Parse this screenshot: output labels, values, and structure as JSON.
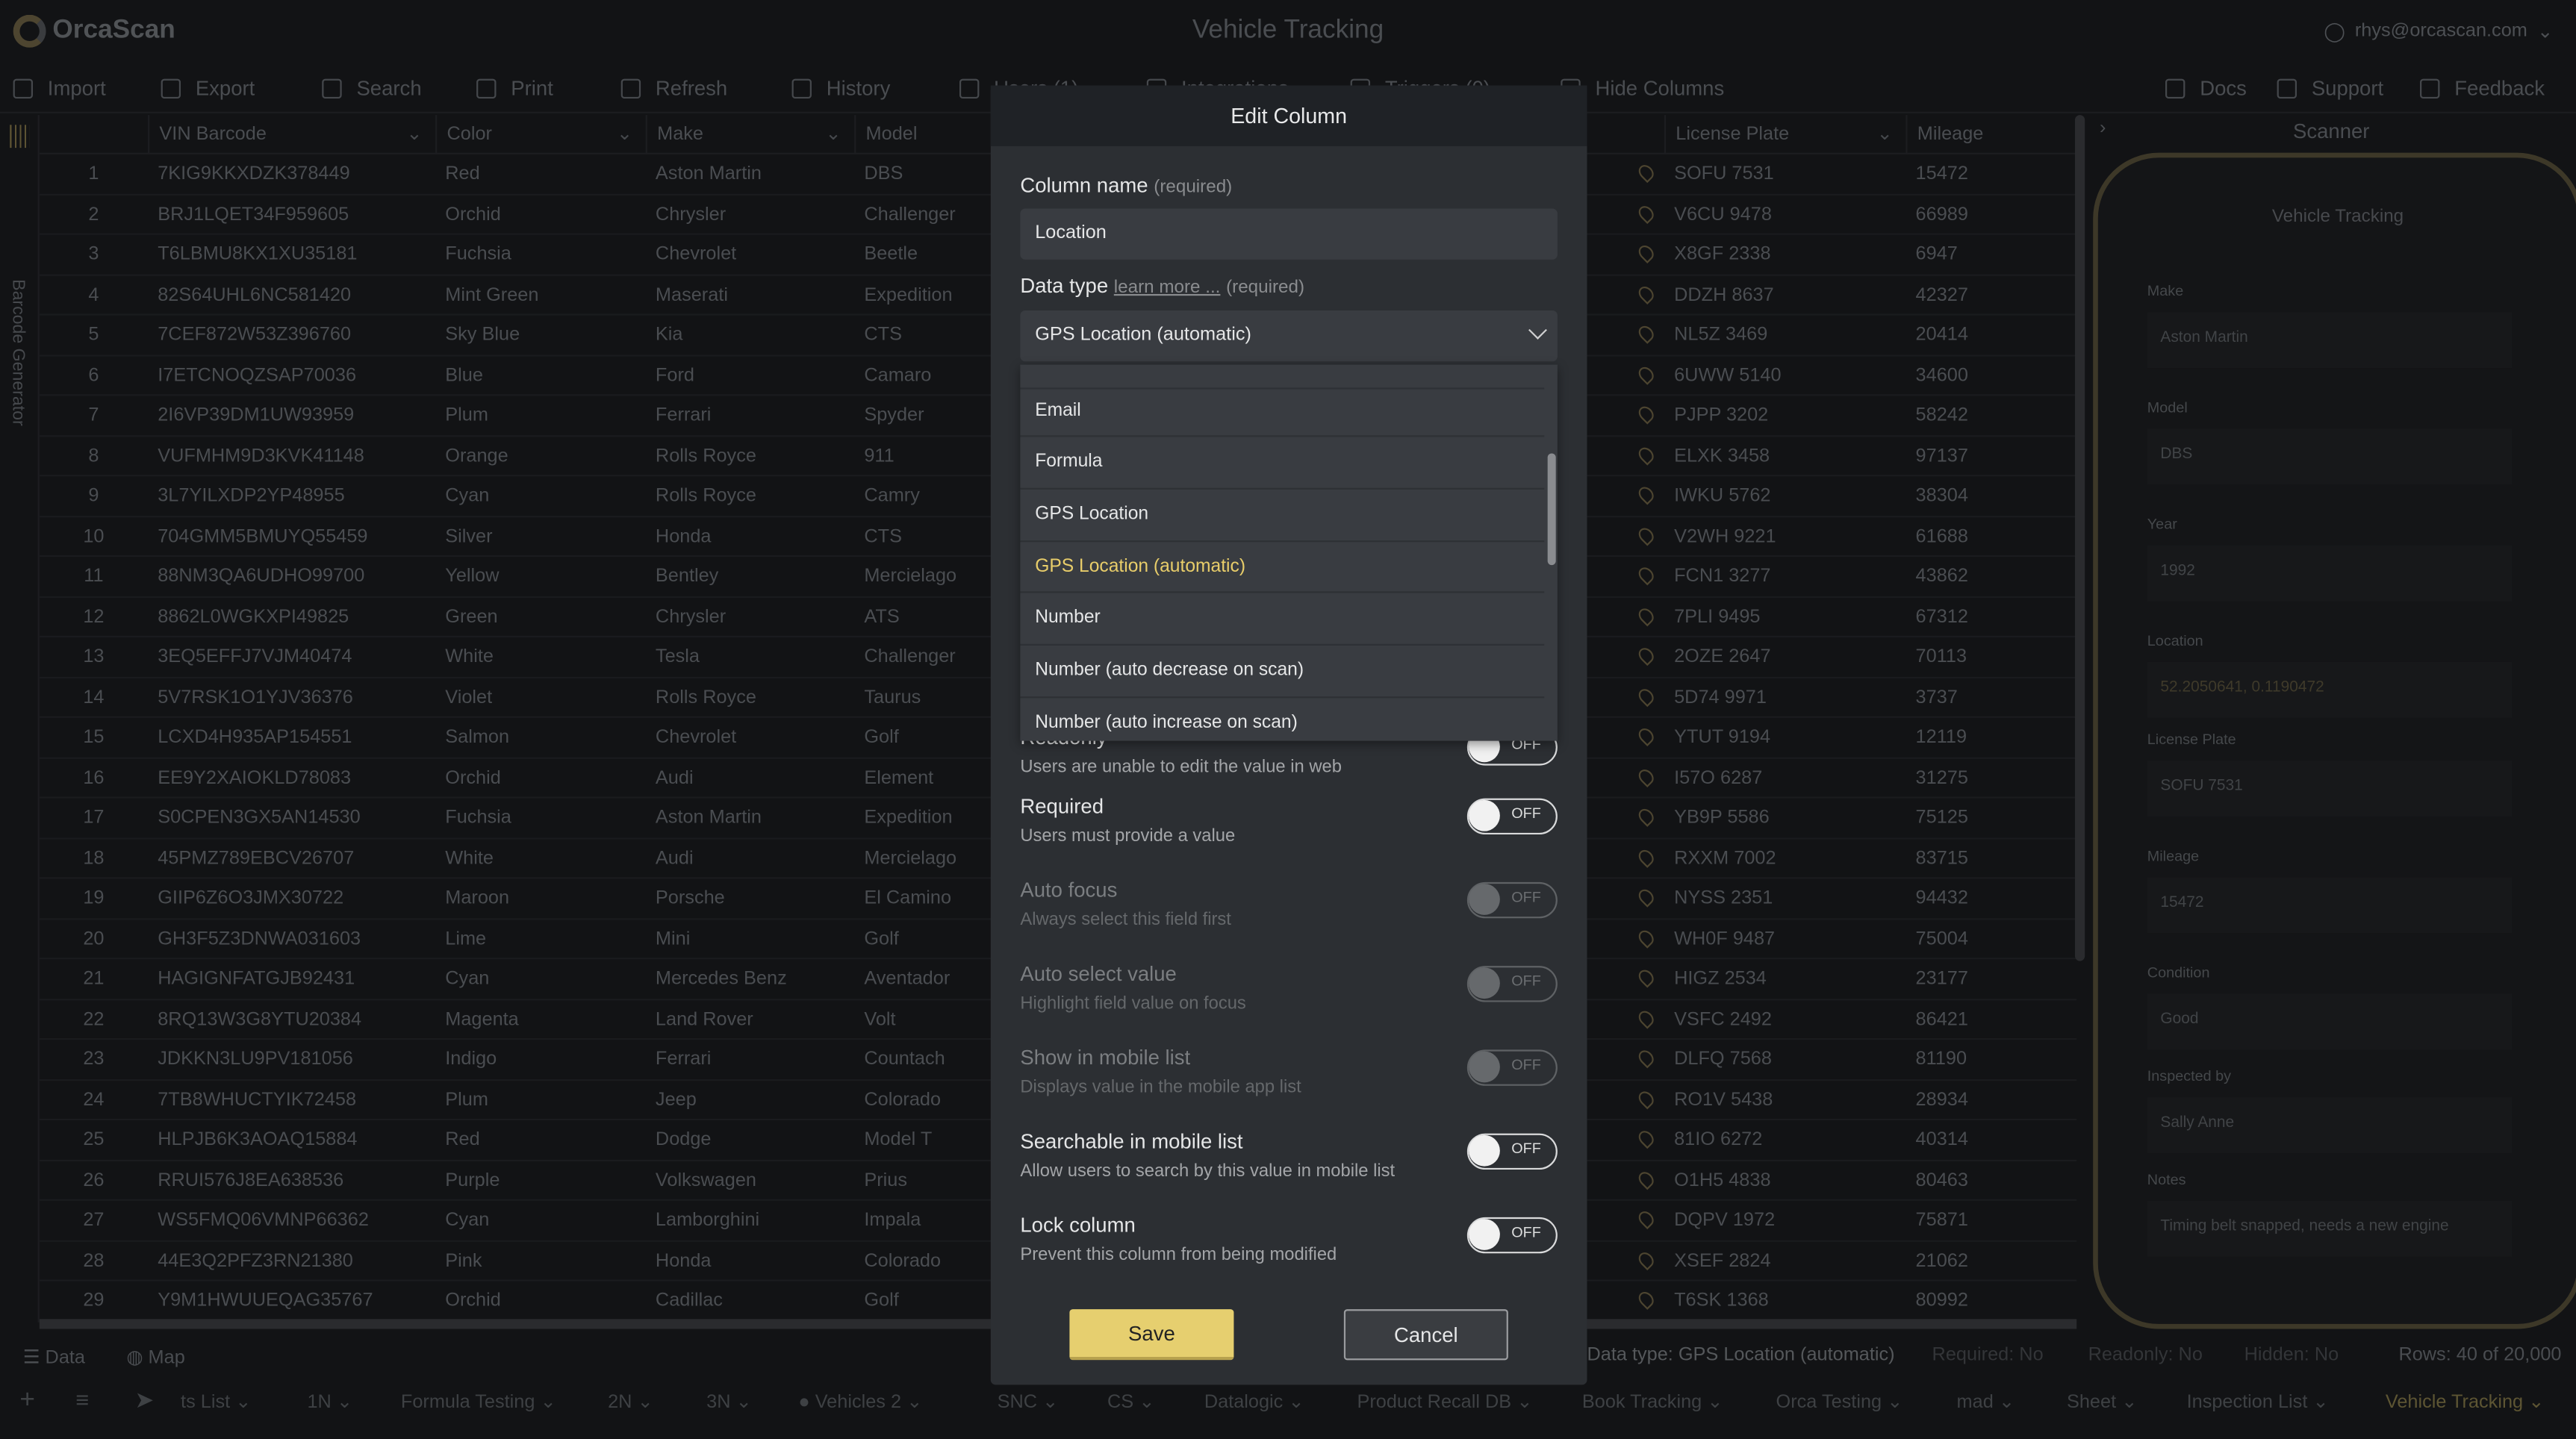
{
  "app": {
    "logo": "OrcaScan",
    "title": "Vehicle Tracking",
    "user_email": "rhys@orcascan.com"
  },
  "colors": {
    "accent": "#e6cf6f",
    "selected_option": "#e8cd6a",
    "background": "#121315",
    "dialog": "#2c2f33"
  },
  "toolbar": {
    "left": [
      {
        "label": "Import",
        "icon": "import-icon"
      },
      {
        "label": "Export",
        "icon": "export-icon"
      },
      {
        "label": "Search",
        "icon": "search-icon"
      },
      {
        "label": "Print",
        "icon": "print-icon"
      },
      {
        "label": "Refresh",
        "icon": "refresh-icon"
      },
      {
        "label": "History",
        "icon": "history-icon"
      },
      {
        "label": "Users (1)",
        "icon": "users-icon"
      },
      {
        "label": "Integrations",
        "icon": "integrations-icon"
      },
      {
        "label": "Triggers (0)",
        "icon": "triggers-icon"
      },
      {
        "label": "Hide Columns",
        "icon": "hide-columns-icon"
      }
    ],
    "right": [
      {
        "label": "Docs",
        "icon": "docs-icon"
      },
      {
        "label": "Support",
        "icon": "support-icon"
      },
      {
        "label": "Feedback",
        "icon": "feedback-icon"
      }
    ]
  },
  "sidebar_strip": {
    "label": "Barcode Generator"
  },
  "table": {
    "columns": [
      "VIN Barcode",
      "Color",
      "Make",
      "Model",
      "License Plate",
      "Mileage"
    ],
    "rows": [
      [
        "1",
        "7KIG9KKXDZK378449",
        "Red",
        "Aston Martin",
        "DBS",
        "SOFU 7531",
        "15472"
      ],
      [
        "2",
        "BRJ1LQET34F959605",
        "Orchid",
        "Chrysler",
        "Challenger",
        "V6CU 9478",
        "66989"
      ],
      [
        "3",
        "T6LBMU8KX1XU35181",
        "Fuchsia",
        "Chevrolet",
        "Beetle",
        "X8GF 2338",
        "6947"
      ],
      [
        "4",
        "82S64UHL6NC581420",
        "Mint Green",
        "Maserati",
        "Expedition",
        "DDZH 8637",
        "42327"
      ],
      [
        "5",
        "7CEF872W53Z396760",
        "Sky Blue",
        "Kia",
        "CTS",
        "NL5Z 3469",
        "20414"
      ],
      [
        "6",
        "I7ETCNOQZSAP70036",
        "Blue",
        "Ford",
        "Camaro",
        "6UWW 5140",
        "34600"
      ],
      [
        "7",
        "2I6VP39DM1UW93959",
        "Plum",
        "Ferrari",
        "Spyder",
        "PJPP 3202",
        "58242"
      ],
      [
        "8",
        "VUFMHM9D3KVK41148",
        "Orange",
        "Rolls Royce",
        "911",
        "ELXK 3458",
        "97137"
      ],
      [
        "9",
        "3L7YILXDP2YP48955",
        "Cyan",
        "Rolls Royce",
        "Camry",
        "IWKU 5762",
        "38304"
      ],
      [
        "10",
        "704GMM5BMUYQ55459",
        "Silver",
        "Honda",
        "CTS",
        "V2WH 9221",
        "61688"
      ],
      [
        "11",
        "88NM3QA6UDHO99700",
        "Yellow",
        "Bentley",
        "Mercielago",
        "FCN1 3277",
        "43862"
      ],
      [
        "12",
        "8862L0WGKXPI49825",
        "Green",
        "Chrysler",
        "ATS",
        "7PLI 9495",
        "67312"
      ],
      [
        "13",
        "3EQ5EFFJ7VJM40474",
        "White",
        "Tesla",
        "Challenger",
        "2OZE 2647",
        "70113"
      ],
      [
        "14",
        "5V7RSK1O1YJV36376",
        "Violet",
        "Rolls Royce",
        "Taurus",
        "5D74 9971",
        "3737"
      ],
      [
        "15",
        "LCXD4H935AP154551",
        "Salmon",
        "Chevrolet",
        "Golf",
        "YTUT 9194",
        "12119"
      ],
      [
        "16",
        "EE9Y2XAIOKLD78083",
        "Orchid",
        "Audi",
        "Element",
        "I57O 6287",
        "31275"
      ],
      [
        "17",
        "S0CPEN3GX5AN14530",
        "Fuchsia",
        "Aston Martin",
        "Expedition",
        "YB9P 5586",
        "75125"
      ],
      [
        "18",
        "45PMZ789EBCV26707",
        "White",
        "Audi",
        "Mercielago",
        "RXXM 7002",
        "83715"
      ],
      [
        "19",
        "GIIP6Z6O3JMX30722",
        "Maroon",
        "Porsche",
        "El Camino",
        "NYSS 2351",
        "94432"
      ],
      [
        "20",
        "GH3F5Z3DNWA031603",
        "Lime",
        "Mini",
        "Golf",
        "WH0F 9487",
        "75004"
      ],
      [
        "21",
        "HAGIGNFATGJB92431",
        "Cyan",
        "Mercedes Benz",
        "Aventador",
        "HIGZ 2534",
        "23177"
      ],
      [
        "22",
        "8RQ13W3G8YTU20384",
        "Magenta",
        "Land Rover",
        "Volt",
        "VSFC 2492",
        "86421"
      ],
      [
        "23",
        "JDKKN3LU9PV181056",
        "Indigo",
        "Ferrari",
        "Countach",
        "DLFQ 7568",
        "81190"
      ],
      [
        "24",
        "7TB8WHUCTYIK72458",
        "Plum",
        "Jeep",
        "Colorado",
        "RO1V 5438",
        "28934"
      ],
      [
        "25",
        "HLPJB6K3AOAQ15884",
        "Red",
        "Dodge",
        "Model T",
        "81IO 6272",
        "40314"
      ],
      [
        "26",
        "RRUI576J8EA638536",
        "Purple",
        "Volkswagen",
        "Prius",
        "O1H5 4838",
        "80463"
      ],
      [
        "27",
        "WS5FMQ06VMNP66362",
        "Cyan",
        "Lamborghini",
        "Impala",
        "DQPV 1972",
        "75871"
      ],
      [
        "28",
        "44E3Q2PFZ3RN21380",
        "Pink",
        "Honda",
        "Colorado",
        "XSEF 2824",
        "21062"
      ],
      [
        "29",
        "Y9M1HWUUEQAG35767",
        "Orchid",
        "Cadillac",
        "Golf",
        "T6SK 1368",
        "80992"
      ]
    ]
  },
  "scanner": {
    "title": "Scanner",
    "sheet_title": "Vehicle Tracking",
    "fields": [
      {
        "label": "Make",
        "value": "Aston Martin"
      },
      {
        "label": "Model",
        "value": "DBS"
      },
      {
        "label": "Year",
        "value": "1992"
      },
      {
        "label": "Location",
        "value": "52.2050641, 0.1190472"
      },
      {
        "label": "License Plate",
        "value": "SOFU 7531"
      },
      {
        "label": "Mileage",
        "value": "15472"
      },
      {
        "label": "Condition",
        "value": "Good"
      },
      {
        "label": "Inspected by",
        "value": "Sally Anne"
      },
      {
        "label": "Notes",
        "value": "Timing belt snapped, needs a new engine"
      }
    ]
  },
  "statusbar": {
    "data_label": "Data",
    "map_label": "Map",
    "data_type": "Data type: GPS Location (automatic)",
    "required": "Required: No",
    "readonly": "Readonly: No",
    "hidden": "Hidden: No",
    "rows": "Rows: 40 of 20,000"
  },
  "sheet_tabs": [
    "ts List",
    "1N",
    "Formula Testing",
    "2N",
    "3N",
    "Vehicles 2",
    "SNC",
    "CS",
    "Datalogic",
    "Product Recall DB",
    "Book Tracking",
    "Orca Testing",
    "mad",
    "Sheet",
    "Inspection List",
    "Vehicle Tracking"
  ],
  "active_sheet": "Vehicle Tracking",
  "dialog": {
    "title": "Edit Column",
    "column_name_label": "Column name",
    "required_hint": "(required)",
    "column_name_value": "Location",
    "data_type_label": "Data type",
    "learn_more": "learn more ...",
    "data_type_value": "GPS Location (automatic)",
    "options": [
      "Email",
      "Formula",
      "GPS Location",
      "GPS Location (automatic)",
      "Number",
      "Number (auto decrease on scan)",
      "Number (auto increase on scan)"
    ],
    "selected_option": "GPS Location (automatic)",
    "settings": [
      {
        "title": "Readonly",
        "desc": "Users are unable to edit the value in web",
        "state": "OFF",
        "enabled": true
      },
      {
        "title": "Required",
        "desc": "Users must provide a value",
        "state": "OFF",
        "enabled": true
      },
      {
        "title": "Auto focus",
        "desc": "Always select this field first",
        "state": "OFF",
        "enabled": false
      },
      {
        "title": "Auto select value",
        "desc": "Highlight field value on focus",
        "state": "OFF",
        "enabled": false
      },
      {
        "title": "Show in mobile list",
        "desc": "Displays value in the mobile app list",
        "state": "OFF",
        "enabled": false
      },
      {
        "title": "Searchable in mobile list",
        "desc": "Allow users to search by this value in mobile list",
        "state": "OFF",
        "enabled": true
      },
      {
        "title": "Lock column",
        "desc": "Prevent this column from being modified",
        "state": "OFF",
        "enabled": true
      }
    ],
    "save_label": "Save",
    "cancel_label": "Cancel"
  }
}
